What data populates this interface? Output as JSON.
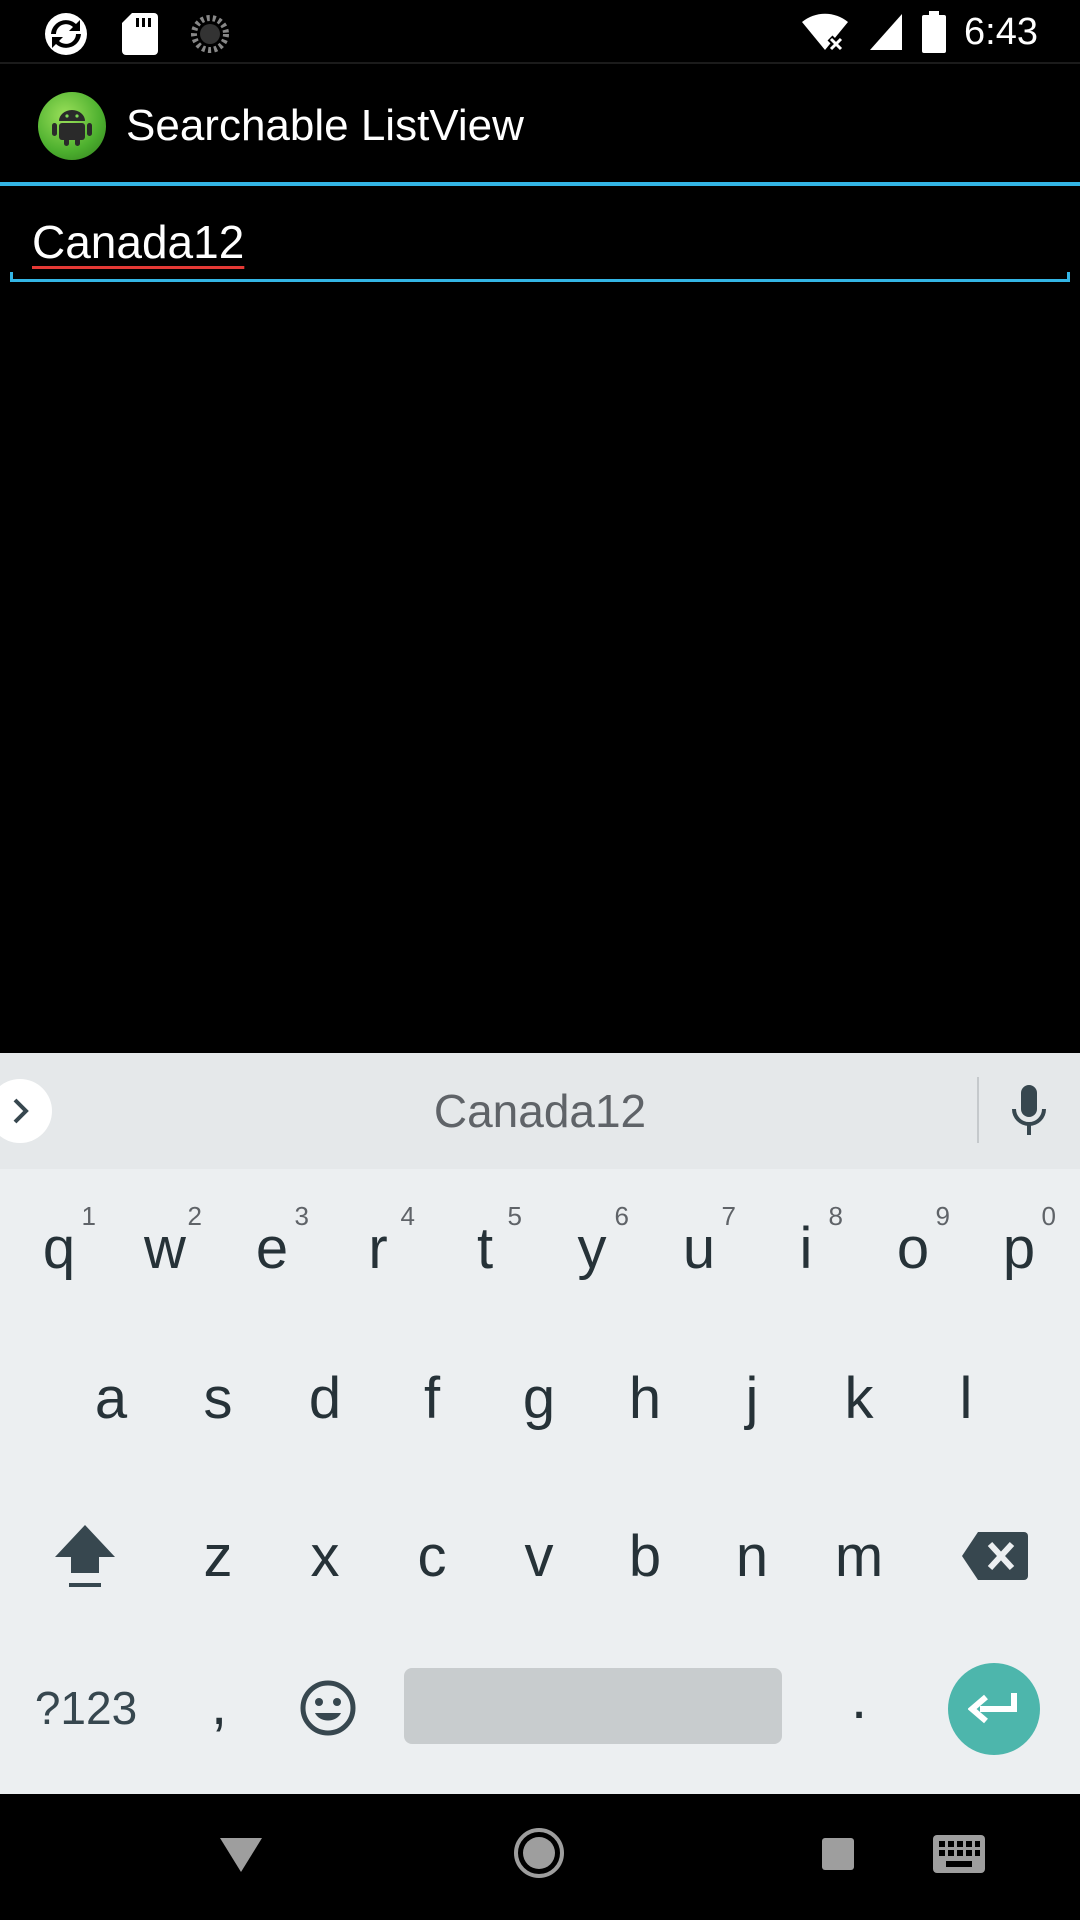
{
  "status_bar": {
    "time": "6:43",
    "left_icons": [
      "sync-icon",
      "sd-card-icon",
      "loading-icon"
    ],
    "right_icons": [
      "wifi-off-icon",
      "signal-icon",
      "battery-icon"
    ]
  },
  "action_bar": {
    "title": "Searchable ListView",
    "icon": "android-app-icon"
  },
  "search": {
    "value": "Canada12"
  },
  "keyboard": {
    "suggestion": "Canada12",
    "row1": [
      {
        "key": "q",
        "hint": "1"
      },
      {
        "key": "w",
        "hint": "2"
      },
      {
        "key": "e",
        "hint": "3"
      },
      {
        "key": "r",
        "hint": "4"
      },
      {
        "key": "t",
        "hint": "5"
      },
      {
        "key": "y",
        "hint": "6"
      },
      {
        "key": "u",
        "hint": "7"
      },
      {
        "key": "i",
        "hint": "8"
      },
      {
        "key": "o",
        "hint": "9"
      },
      {
        "key": "p",
        "hint": "0"
      }
    ],
    "row2": [
      "a",
      "s",
      "d",
      "f",
      "g",
      "h",
      "j",
      "k",
      "l"
    ],
    "row3": [
      "z",
      "x",
      "c",
      "v",
      "b",
      "n",
      "m"
    ],
    "symbols_label": "?123",
    "comma": ",",
    "period": ".",
    "accent_color": "#4db6ac"
  },
  "nav_bar": {
    "icons": [
      "back-icon",
      "home-icon",
      "recents-icon",
      "keyboard-switch-icon"
    ]
  }
}
